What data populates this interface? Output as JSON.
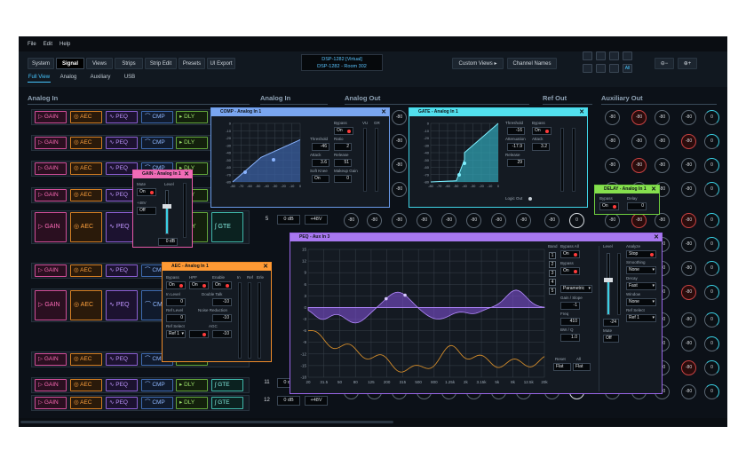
{
  "menu": [
    "File",
    "Edit",
    "Help"
  ],
  "tabs": [
    "System",
    "Signal",
    "Views",
    "Strips",
    "Strip Edit",
    "Presets",
    "UI Export"
  ],
  "subtabs": [
    "Full View",
    "Analog",
    "Auxiliary",
    "USB"
  ],
  "device": {
    "line1": "DSP-1282 [Virtual]",
    "line2": "DSP-1282 - Room 302"
  },
  "custom_views": "Custom Views",
  "channel_names": "Channel Names",
  "all_label": "All",
  "sections": {
    "analog_in_left": "Analog In",
    "analog_in_mid": "Analog In",
    "analog_out": "Analog Out",
    "ref_out": "Ref Out",
    "aux_out": "Auxiliary Out"
  },
  "modules": {
    "gain": "GAIN",
    "aec": "AEC",
    "peq": "PEQ",
    "cmp": "CMP",
    "dly": "DLY",
    "gte": "GTE"
  },
  "channels": {
    "five": "5",
    "eleven": "11",
    "twelve": "12"
  },
  "db0": "0 dB",
  "p48": "+48V",
  "knob_vals": {
    "a": "-80",
    "b": "0"
  },
  "comp": {
    "title": "COMP - Analog In 1",
    "bypass": "Bypass",
    "on": "On",
    "threshold": "Threshold",
    "threshold_val": "-46",
    "ratio": "Ratio",
    "ratio_val": "2",
    "attack": "Attack",
    "attack_val": "3.6",
    "release": "Release",
    "release_val": "51",
    "softknee": "Soft Knee",
    "softknee_val": "On",
    "makeup": "Makeup Gain",
    "makeup_val": "0",
    "vu": "VU",
    "gr": "GR",
    "yticks": [
      "0",
      "-10",
      "-20",
      "-30",
      "-40",
      "-50",
      "-60",
      "-70",
      "-80"
    ],
    "xticks": [
      "-80",
      "-70",
      "-60",
      "-50",
      "-40",
      "-30",
      "-20",
      "-10",
      "0"
    ]
  },
  "gate": {
    "title": "GATE - Analog In 1",
    "threshold": "Threshold",
    "threshold_val": "-16",
    "bypass": "Bypass",
    "bypass_val": "On",
    "attenuation": "Attenuation",
    "attenuation_val": "-17.9",
    "attack": "Attack",
    "attack_val": "3.2",
    "release": "Release",
    "release_val": "29",
    "logic_out": "Logic Out",
    "yticks": [
      "0",
      "-10",
      "-20",
      "-30",
      "-40",
      "-50",
      "-60",
      "-70",
      "-80"
    ],
    "xticks": [
      "-80",
      "-70",
      "-60",
      "-50",
      "-40",
      "-30",
      "-20",
      "-10",
      "0"
    ]
  },
  "gainw": {
    "title": "GAIN - Analog In 1",
    "mute": "Mute",
    "mute_val": "On",
    "level": "Level",
    "p48": "+48V",
    "p48_val": "Off",
    "db": "0 dB"
  },
  "aecw": {
    "title": "AEC - Analog In 1",
    "bypass": "Bypass",
    "bypass_val": "On",
    "hpf": "HPF",
    "hpf_val": "On",
    "enable": "Enable",
    "enable_val": "On",
    "in": "In",
    "ref": "Ref",
    "erle": "Erle",
    "inlevel": "In Level",
    "inlevel_val": "0",
    "doubletalk": "Double Talk",
    "doubletalk_val": "-10",
    "reflevel": "Ref Level",
    "reflevel_val": "0",
    "noisered": "Noise Reduction",
    "noisered_val": "-10",
    "refselect": "Ref Select",
    "refselect_val": "Ref 1",
    "agc": "AGC",
    "agc_val": "-10"
  },
  "delayw": {
    "title": "DELAY - Analog In 1",
    "bypass": "Bypass",
    "bypass_val": "On",
    "delay": "Delay",
    "delay_val": "0"
  },
  "peqw": {
    "title": "PEQ - Aux In 3",
    "bypass_all": "Bypass All",
    "bypass_all_val": "On",
    "bypass": "Bypass",
    "bypass_val": "On",
    "band": "Band",
    "bands": [
      "1",
      "2",
      "3",
      "4",
      "5"
    ],
    "type_val": "Parametric",
    "gainslope": "Gain / Slope",
    "gainslope_val": "-1",
    "freq": "Freq",
    "freq_val": "410",
    "bwq": "BW / Q",
    "bwq_val": "1.0",
    "reset": "Reset",
    "all": "All",
    "flat": "Flat",
    "flat2": "Flat",
    "level": "Level",
    "level_val": "-24",
    "mute": "Mute",
    "mute_val": "Off",
    "analyze": "Analyze",
    "analyze_val": "Stop",
    "smoothing": "Smoothing",
    "smoothing_val": "None",
    "decay": "Decay",
    "decay_val": "Fast",
    "window": "Window",
    "window_val": "None",
    "refselect": "Ref Select",
    "refselect_val": "Ref 1",
    "yticks": [
      "15",
      "12",
      "9",
      "6",
      "3",
      "0",
      "-3",
      "-6",
      "-9",
      "-12",
      "-15",
      "-18"
    ],
    "xticks": [
      "20",
      "31.5",
      "50",
      "80",
      "125",
      "200",
      "315",
      "500",
      "800",
      "1.25k",
      "2k",
      "3.15k",
      "5k",
      "8k",
      "12.5k",
      "20k"
    ]
  }
}
